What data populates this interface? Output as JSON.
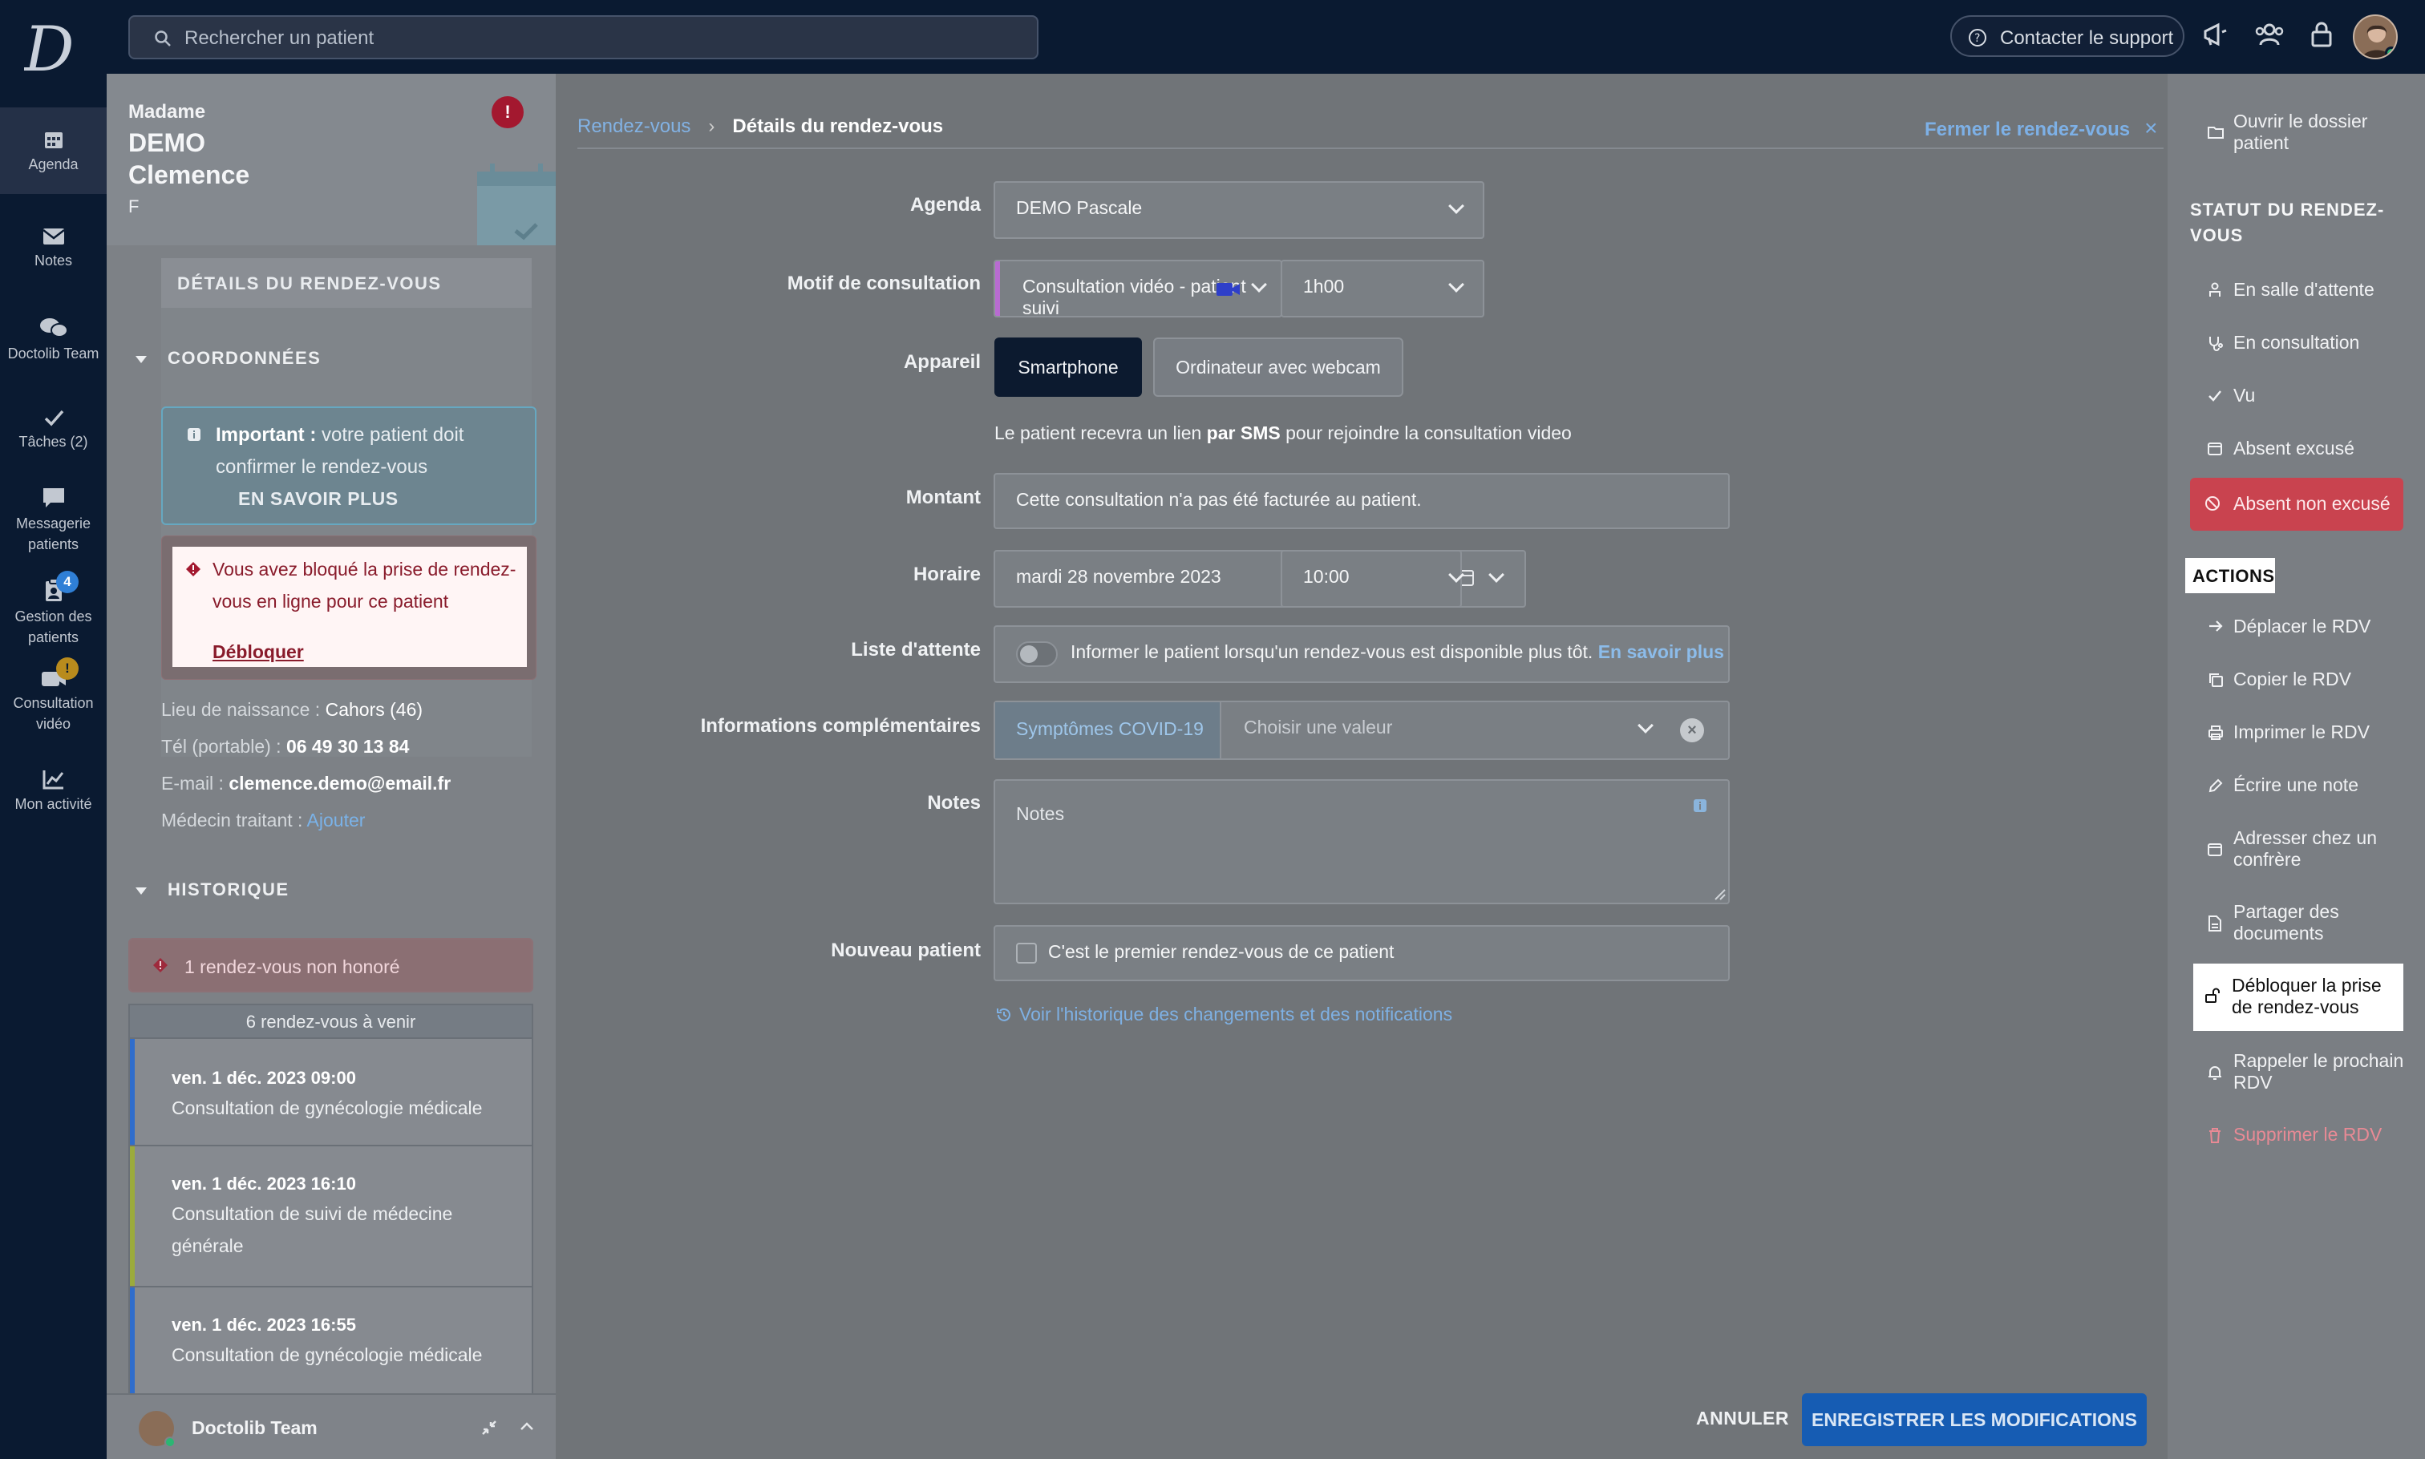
{
  "topbar": {
    "logo_letter": "D",
    "search_placeholder": "Rechercher un patient",
    "support_label": "Contacter le support",
    "icons": [
      "megaphone-icon",
      "team-icon",
      "lock-icon",
      "user-avatar"
    ]
  },
  "leftnav": {
    "items": [
      {
        "label": "Agenda",
        "icon": "calendar-icon",
        "active": true
      },
      {
        "label": "Notes",
        "icon": "mail-icon"
      },
      {
        "label": "Doctolib Team",
        "icon": "chat-bubbles-icon"
      },
      {
        "label": "Tâches (2)",
        "icon": "check-icon"
      },
      {
        "label": "Messagerie patients",
        "icon": "message-icon"
      },
      {
        "label": "Gestion des patients",
        "icon": "clipboard-icon",
        "badge": "4"
      },
      {
        "label": "Consultation vidéo",
        "icon": "video-icon",
        "badge": "!"
      },
      {
        "label": "Mon activité",
        "icon": "chart-icon"
      }
    ]
  },
  "patient": {
    "civility": "Madame",
    "last_name": "DEMO",
    "first_name": "Clemence",
    "sex": "F",
    "tab_label": "DÉTAILS DU RENDEZ-VOUS",
    "coord_title": "COORDONNÉES",
    "important_bold": "Important :",
    "important_text": "votre patient doit confirmer le rendez-vous",
    "important_more": "EN SAVOIR PLUS",
    "blocked_text": "Vous avez bloqué la prise de rendez-vous en ligne pour ce patient",
    "blocked_link": "Débloquer",
    "birthplace_label": "Lieu de naissance :",
    "birthplace": "Cahors (46)",
    "phone_label": "Tél (portable) :",
    "phone": "06 49 30 13 84",
    "email_label": "E-mail :",
    "email": "clemence.demo@email.fr",
    "doctor_label": "Médecin traitant :",
    "doctor_link": "Ajouter",
    "history_title": "HISTORIQUE",
    "not_honored": "1 rendez-vous non honoré",
    "upcoming_header": "6 rendez-vous à venir",
    "appointments": [
      {
        "date": "ven. 1 déc. 2023 09:00",
        "desc": "Consultation de gynécologie médicale",
        "color": "#2f6dcc"
      },
      {
        "date": "ven. 1 déc. 2023 16:10",
        "desc": "Consultation de suivi de médecine générale",
        "color": "#9bab3c"
      },
      {
        "date": "ven. 1 déc. 2023 16:55",
        "desc": "Consultation de gynécologie médicale",
        "color": "#2f6dcc"
      }
    ],
    "team_bar": "Doctolib Team"
  },
  "main": {
    "breadcrumb_link": "Rendez-vous",
    "breadcrumb_current": "Détails du rendez-vous",
    "close_label": "Fermer le rendez-vous",
    "agenda_label": "Agenda",
    "agenda_value": "DEMO Pascale",
    "motif_label": "Motif de consultation",
    "motif_value": "Consultation vidéo - patient suivi",
    "duration_value": "1h00",
    "device_label": "Appareil",
    "device_options": [
      "Smartphone",
      "Ordinateur avec webcam"
    ],
    "device_selected": "Smartphone",
    "sms_pre": "Le patient recevra un lien",
    "sms_bold": "par SMS",
    "sms_post": "pour rejoindre la consultation video",
    "amount_label": "Montant",
    "amount_value": "Cette consultation n'a pas été facturée au patient.",
    "schedule_label": "Horaire",
    "date_value": "mardi 28 novembre 2023",
    "time_value": "10:00",
    "waitlist_label": "Liste d'attente",
    "waitlist_text": "Informer le patient lorsqu'un rendez-vous est disponible plus tôt.",
    "waitlist_link": "En savoir plus",
    "info_label": "Informations complémentaires",
    "info_tag": "Symptômes COVID-19",
    "info_placeholder": "Choisir une valeur",
    "notes_label": "Notes",
    "notes_placeholder": "Notes",
    "newpatient_label": "Nouveau patient",
    "newpatient_text": "C'est le premier rendez-vous de ce patient",
    "history_link": "Voir l'historique des changements et des notifications",
    "cancel_label": "ANNULER",
    "save_label": "ENREGISTRER LES MODIFICATIONS"
  },
  "right": {
    "open_file": "Ouvrir le dossier patient",
    "status_title": "STATUT DU RENDEZ-VOUS",
    "status_items": [
      {
        "label": "En salle d'attente",
        "icon": "waiting-room-icon"
      },
      {
        "label": "En consultation",
        "icon": "stethoscope-icon"
      },
      {
        "label": "Vu",
        "icon": "check-icon"
      },
      {
        "label": "Absent excusé",
        "icon": "calendar-x-icon"
      }
    ],
    "absent_unexcused": "Absent non excusé",
    "actions_title": "ACTIONS",
    "actions": [
      {
        "label": "Déplacer le RDV",
        "icon": "arrow-right-icon"
      },
      {
        "label": "Copier le RDV",
        "icon": "copy-icon"
      },
      {
        "label": "Imprimer le RDV",
        "icon": "printer-icon"
      },
      {
        "label": "Écrire une note",
        "icon": "edit-icon"
      },
      {
        "label": "Adresser chez un confrère",
        "icon": "calendar-icon"
      },
      {
        "label": "Partager des documents",
        "icon": "document-icon"
      },
      {
        "label": "Débloquer la prise de rendez-vous",
        "icon": "unlock-icon"
      },
      {
        "label": "Rappeler le prochain RDV",
        "icon": "bell-icon"
      },
      {
        "label": "Supprimer le RDV",
        "icon": "trash-icon"
      }
    ]
  }
}
